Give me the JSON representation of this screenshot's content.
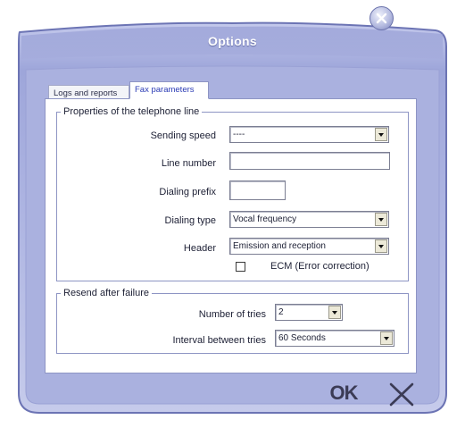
{
  "dialog": {
    "title": "Options"
  },
  "tabs": [
    {
      "label": "Logs and reports",
      "active": false
    },
    {
      "label": "Fax parameters",
      "active": true
    }
  ],
  "groups": {
    "line_properties": {
      "legend": "Properties of the telephone line",
      "sending_speed": {
        "label": "Sending speed",
        "value": "----"
      },
      "line_number": {
        "label": "Line number",
        "value": ""
      },
      "dialing_prefix": {
        "label": "Dialing prefix",
        "value": ""
      },
      "dialing_type": {
        "label": "Dialing type",
        "value": "Vocal frequency"
      },
      "header": {
        "label": "Header",
        "value": "Emission and reception"
      },
      "ecm": {
        "label": "ECM (Error correction)",
        "checked": false
      }
    },
    "resend": {
      "legend": "Resend after failure",
      "number_of_tries": {
        "label": "Number of tries",
        "value": "2"
      },
      "interval": {
        "label": "Interval between tries",
        "value": "60 Seconds"
      }
    }
  },
  "buttons": {
    "ok_label": "OK",
    "cancel_icon": "x-icon",
    "close_icon": "close-icon"
  },
  "colors": {
    "frame": "#a9b0dd",
    "frame_dark": "#6c74b4",
    "active_tab_text": "#2b3bb5"
  }
}
